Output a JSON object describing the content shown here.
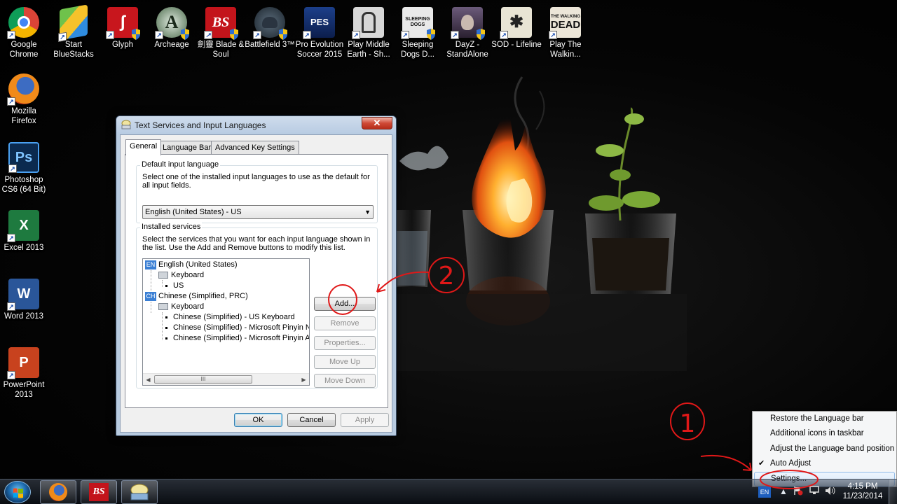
{
  "desktop": {
    "icons": [
      {
        "label": "Google Chrome",
        "icon": "chrome-icon"
      },
      {
        "label": "Start BlueStacks",
        "icon": "bluestacks-icon"
      },
      {
        "label": "Glyph",
        "icon": "glyph-icon"
      },
      {
        "label": "Archeage",
        "icon": "archeage-icon"
      },
      {
        "label": "劍靈 Blade & Soul",
        "icon": "blade-and-soul-icon"
      },
      {
        "label": "Battlefield 3™",
        "icon": "battlefield-icon"
      },
      {
        "label": "Pro Evolution Soccer 2015",
        "icon": "pes-icon"
      },
      {
        "label": "Play Middle Earth - Sh...",
        "icon": "middle-earth-icon"
      },
      {
        "label": "Sleeping Dogs D...",
        "icon": "sleeping-dogs-icon"
      },
      {
        "label": "DayZ - StandAlone",
        "icon": "dayz-icon"
      },
      {
        "label": "SOD - Lifeline",
        "icon": "sod-icon"
      },
      {
        "label": "Play The Walkin...",
        "icon": "walking-dead-icon"
      },
      {
        "label": "Mozilla Firefox",
        "icon": "firefox-icon"
      },
      {
        "label": "Photoshop CS6 (64 Bit)",
        "icon": "photoshop-icon"
      },
      {
        "label": "Excel 2013",
        "icon": "excel-icon"
      },
      {
        "label": "Word 2013",
        "icon": "word-icon"
      },
      {
        "label": "PowerPoint 2013",
        "icon": "powerpoint-icon"
      }
    ],
    "tile_texts": {
      "ps": "Ps",
      "excel": "X",
      "word": "W",
      "powerpoint": "P",
      "walking_dead_top": "THE WALKING",
      "walking_dead_main": "DEAD",
      "sleeping_dogs": "SLEEPING DOGS",
      "pes": "PES",
      "bs": "BS"
    }
  },
  "dialog": {
    "title": "Text Services and Input Languages",
    "close_glyph": "✕",
    "tabs": [
      "General",
      "Language Bar",
      "Advanced Key Settings"
    ],
    "default_input": {
      "group_title": "Default input language",
      "description": "Select one of the installed input languages to use as the default for all input fields.",
      "selected": "English (United States) - US",
      "arrow": "▼"
    },
    "installed_services": {
      "group_title": "Installed services",
      "description": "Select the services that you want for each input language shown in the list. Use the Add and Remove buttons to modify this list.",
      "tree": [
        {
          "badge": "EN",
          "label": "English (United States)"
        },
        {
          "label": "Keyboard"
        },
        {
          "label": "US"
        },
        {
          "badge": "CH",
          "label": "Chinese (Simplified, PRC)"
        },
        {
          "label": "Keyboard"
        },
        {
          "label": "Chinese (Simplified) - US Keyboard"
        },
        {
          "label": "Chinese (Simplified) - Microsoft Pinyin Ne"
        },
        {
          "label": "Chinese (Simplified) - Microsoft Pinyin AE"
        }
      ],
      "scroll_left": "◀",
      "scroll_right": "▶",
      "scroll_grip": "III",
      "buttons": {
        "add": "Add...",
        "remove": "Remove",
        "properties": "Properties...",
        "move_up": "Move Up",
        "move_down": "Move Down"
      }
    },
    "footer": {
      "ok": "OK",
      "cancel": "Cancel",
      "apply": "Apply"
    }
  },
  "language_menu": {
    "items": [
      {
        "label": "Restore the Language bar"
      },
      {
        "label": "Additional icons in taskbar"
      },
      {
        "label": "Adjust the Language band position"
      },
      {
        "label": "Auto Adjust",
        "check": "✔"
      },
      {
        "label": "Settings..."
      }
    ]
  },
  "annotations": {
    "step1": "1",
    "step2": "2"
  },
  "taskbar": {
    "tray_language": "EN",
    "tray_up_arrow": "▲",
    "time": "4:15 PM",
    "date": "11/23/2014"
  }
}
